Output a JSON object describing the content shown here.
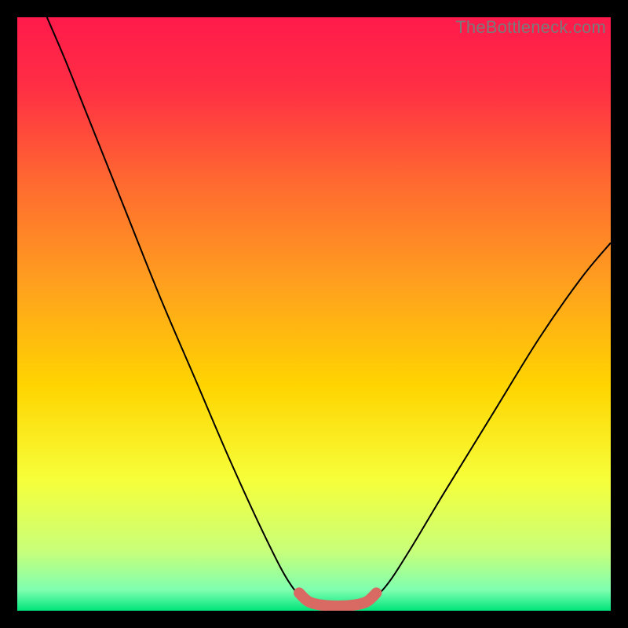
{
  "watermark": "TheBottleneck.com",
  "chart_data": {
    "type": "line",
    "title": "",
    "xlabel": "",
    "ylabel": "",
    "xlim": [
      0,
      100
    ],
    "ylim": [
      0,
      100
    ],
    "grid": false,
    "gradient_stops": [
      {
        "offset": 0.0,
        "color": "#ff1a4b"
      },
      {
        "offset": 0.12,
        "color": "#ff2f44"
      },
      {
        "offset": 0.28,
        "color": "#ff6a30"
      },
      {
        "offset": 0.45,
        "color": "#ffa01e"
      },
      {
        "offset": 0.62,
        "color": "#ffd400"
      },
      {
        "offset": 0.78,
        "color": "#f6ff3a"
      },
      {
        "offset": 0.9,
        "color": "#c8ff7a"
      },
      {
        "offset": 0.965,
        "color": "#7fffb0"
      },
      {
        "offset": 1.0,
        "color": "#00e47a"
      }
    ],
    "series": [
      {
        "name": "bottleneck-curve",
        "stroke": "#000000",
        "stroke_width": 2,
        "points": [
          {
            "x": 5.0,
            "y": 100.0
          },
          {
            "x": 8.0,
            "y": 93.0
          },
          {
            "x": 12.0,
            "y": 83.0
          },
          {
            "x": 18.0,
            "y": 68.0
          },
          {
            "x": 24.0,
            "y": 53.0
          },
          {
            "x": 30.0,
            "y": 39.0
          },
          {
            "x": 36.0,
            "y": 25.0
          },
          {
            "x": 42.0,
            "y": 12.0
          },
          {
            "x": 46.0,
            "y": 4.5
          },
          {
            "x": 49.0,
            "y": 1.5
          },
          {
            "x": 52.0,
            "y": 0.8
          },
          {
            "x": 56.0,
            "y": 0.8
          },
          {
            "x": 59.0,
            "y": 1.5
          },
          {
            "x": 62.0,
            "y": 4.0
          },
          {
            "x": 66.0,
            "y": 10.0
          },
          {
            "x": 72.0,
            "y": 20.0
          },
          {
            "x": 80.0,
            "y": 33.0
          },
          {
            "x": 88.0,
            "y": 46.0
          },
          {
            "x": 95.0,
            "y": 56.0
          },
          {
            "x": 100.0,
            "y": 62.0
          }
        ]
      },
      {
        "name": "low-bottleneck-band",
        "stroke": "#d96a63",
        "stroke_width": 14,
        "linecap": "round",
        "points": [
          {
            "x": 47.5,
            "y": 3.0
          },
          {
            "x": 49.0,
            "y": 1.6
          },
          {
            "x": 51.0,
            "y": 1.0
          },
          {
            "x": 54.0,
            "y": 0.8
          },
          {
            "x": 57.0,
            "y": 1.0
          },
          {
            "x": 59.0,
            "y": 1.6
          },
          {
            "x": 60.5,
            "y": 3.0
          }
        ]
      }
    ]
  }
}
